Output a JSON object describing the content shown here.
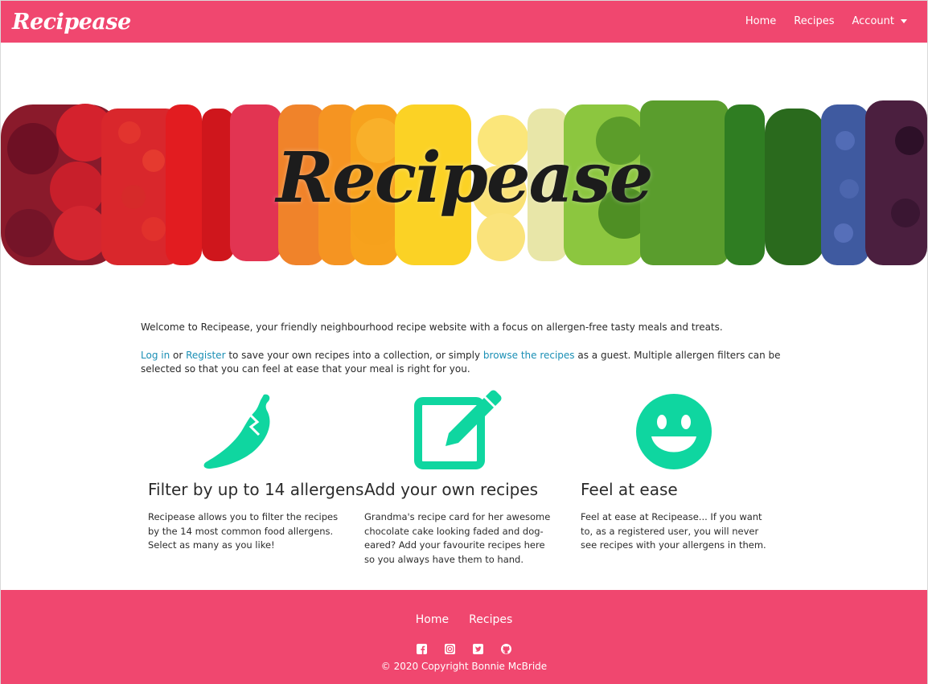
{
  "nav": {
    "brand": "Recipease",
    "links": [
      "Home",
      "Recipes",
      "Account"
    ]
  },
  "hero": {
    "title": "Recipease"
  },
  "intro": {
    "welcome": "Welcome to Recipease, your friendly neighbourhood recipe website with a focus on allergen-free tasty meals and treats.",
    "login_link": "Log in",
    "or_text": " or ",
    "register_link": "Register",
    "mid_text": " to save your own recipes into a collection, or simply ",
    "browse_link": "browse the recipes",
    "end_text": " as a guest. Multiple allergen filters can be selected so that you can feel at ease that your meal is right for you."
  },
  "features": [
    {
      "icon": "chili-pepper-icon",
      "title": "Filter by up to 14 allergens",
      "text": "Recipease allows you to filter the recipes by the 14 most common food allergens. Select as many as you like!"
    },
    {
      "icon": "edit-icon",
      "title": "Add your own recipes",
      "text": "Grandma's recipe card for her awesome chocolate cake looking faded and dog-eared? Add your favourite recipes here so you always have them to hand."
    },
    {
      "icon": "smile-icon",
      "title": "Feel at ease",
      "text": "Feel at ease at Recipease... If you want to, as a registered user, you will never see recipes with your allergens in them."
    }
  ],
  "footer": {
    "links": [
      "Home",
      "Recipes"
    ],
    "social_icons": [
      "facebook-icon",
      "instagram-icon",
      "twitter-icon",
      "github-icon"
    ],
    "copyright": "© 2020 Copyright Bonnie McBride"
  },
  "colors": {
    "brand_pink": "#f0476f",
    "accent_teal": "#0fd6a0",
    "link_blue": "#1a8fb5"
  }
}
